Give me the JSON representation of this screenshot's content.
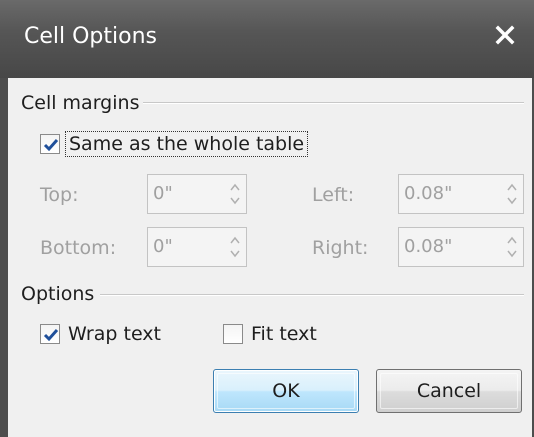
{
  "window": {
    "title": "Cell Options"
  },
  "cell_margins": {
    "group_label": "Cell margins",
    "same_as_table": {
      "label": "Same as the whole table",
      "checked": true
    },
    "fields": {
      "top": {
        "label": "Top:",
        "value": "0\""
      },
      "left": {
        "label": "Left:",
        "value": "0.08\""
      },
      "bottom": {
        "label": "Bottom:",
        "value": "0\""
      },
      "right": {
        "label": "Right:",
        "value": "0.08\""
      }
    }
  },
  "options": {
    "group_label": "Options",
    "wrap_text": {
      "label": "Wrap text",
      "checked": true
    },
    "fit_text": {
      "label": "Fit text",
      "checked": false
    }
  },
  "buttons": {
    "ok": "OK",
    "cancel": "Cancel"
  },
  "colors": {
    "titlebar": "#565656",
    "client": "#f0f0f0",
    "check_blue": "#1f4f9a",
    "disabled_text": "#a0a0a0"
  }
}
